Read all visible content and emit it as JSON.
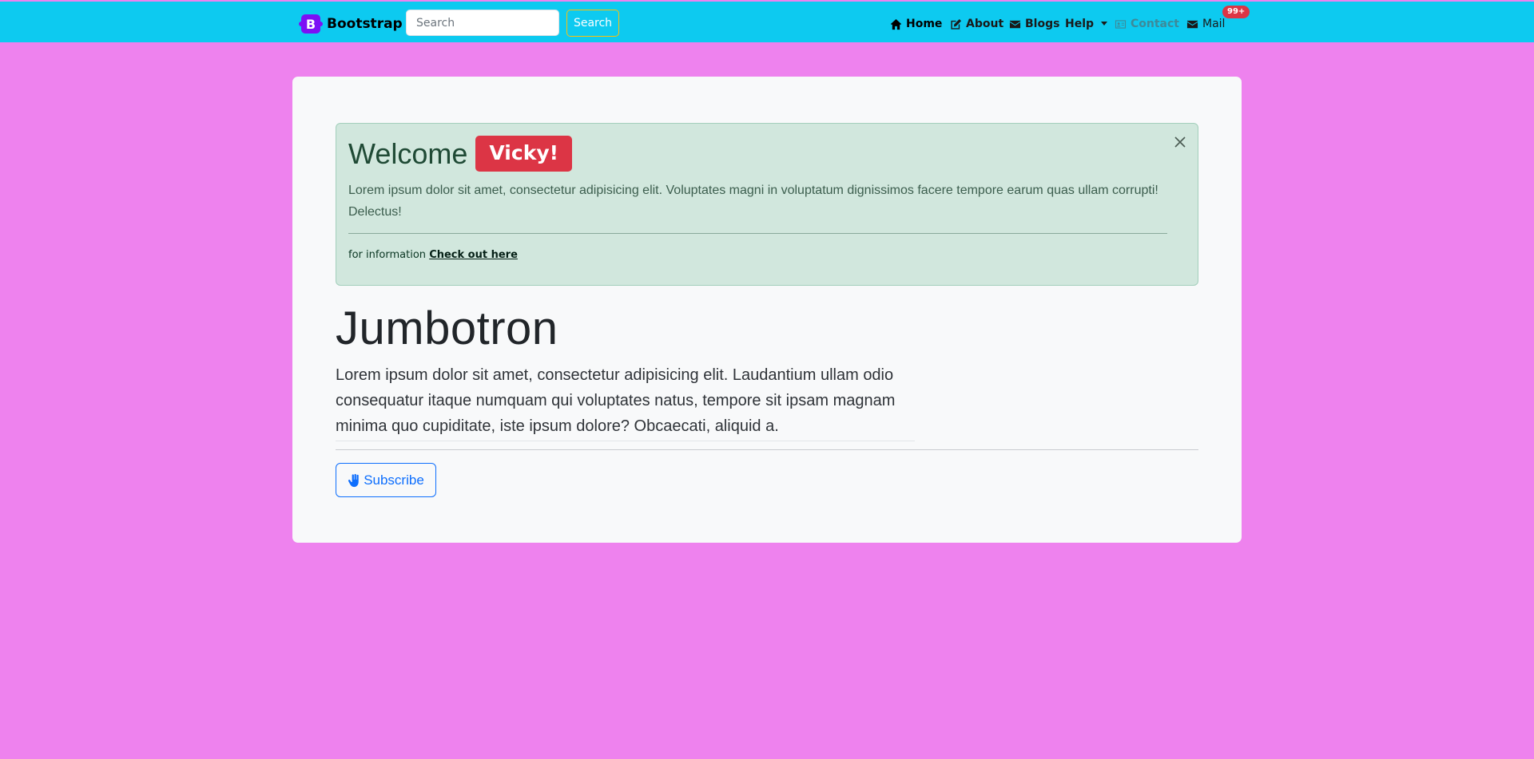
{
  "navbar": {
    "brand_logo_letter": "B",
    "brand_label": "Bootstrap",
    "search_placeholder": "Search",
    "search_button_label": "Search",
    "items": [
      {
        "label": "Home",
        "icon": "home-icon",
        "state": "active"
      },
      {
        "label": "About",
        "icon": "edit-icon",
        "state": "normal"
      },
      {
        "label": "Blogs",
        "icon": "envelope-icon",
        "state": "normal"
      },
      {
        "label": "Help",
        "icon": "chevron-down-icon",
        "state": "dropdown"
      },
      {
        "label": "Contact",
        "icon": "contact-card-icon",
        "state": "disabled"
      },
      {
        "label": "Mail",
        "icon": "envelope-icon",
        "state": "normal"
      }
    ],
    "mail_badge": "99+"
  },
  "alert": {
    "heading_prefix": "Welcome",
    "heading_name": "Vicky!",
    "text": "Lorem ipsum dolor sit amet, consectetur adipisicing elit. Voluptates magni in voluptatum dignissimos facere tempore earum quas ullam corrupti! Delectus!",
    "footer_text": "for information",
    "footer_link": "Check out here"
  },
  "jumbotron": {
    "title": "Jumbotron",
    "lead": "Lorem ipsum dolor sit amet, consectetur adipisicing elit. Laudantium ullam odio consequatur itaque numquam qui voluptates natus, tempore sit ipsam magnam minima quo cupiditate, iste ipsum dolore? Obcaecati, aliquid a.",
    "button_label": "Subscribe",
    "button_icon": "hand-wave-icon"
  },
  "colors": {
    "page_background": "#ee82ee",
    "navbar_background": "#0dcaf0",
    "card_background": "#f8f9fa",
    "alert_background": "#d1e7dd",
    "badge_red": "#dc3545",
    "brand_purple": "#7c10f5",
    "primary_blue": "#0d6efd",
    "search_button_border": "#ffc107"
  }
}
